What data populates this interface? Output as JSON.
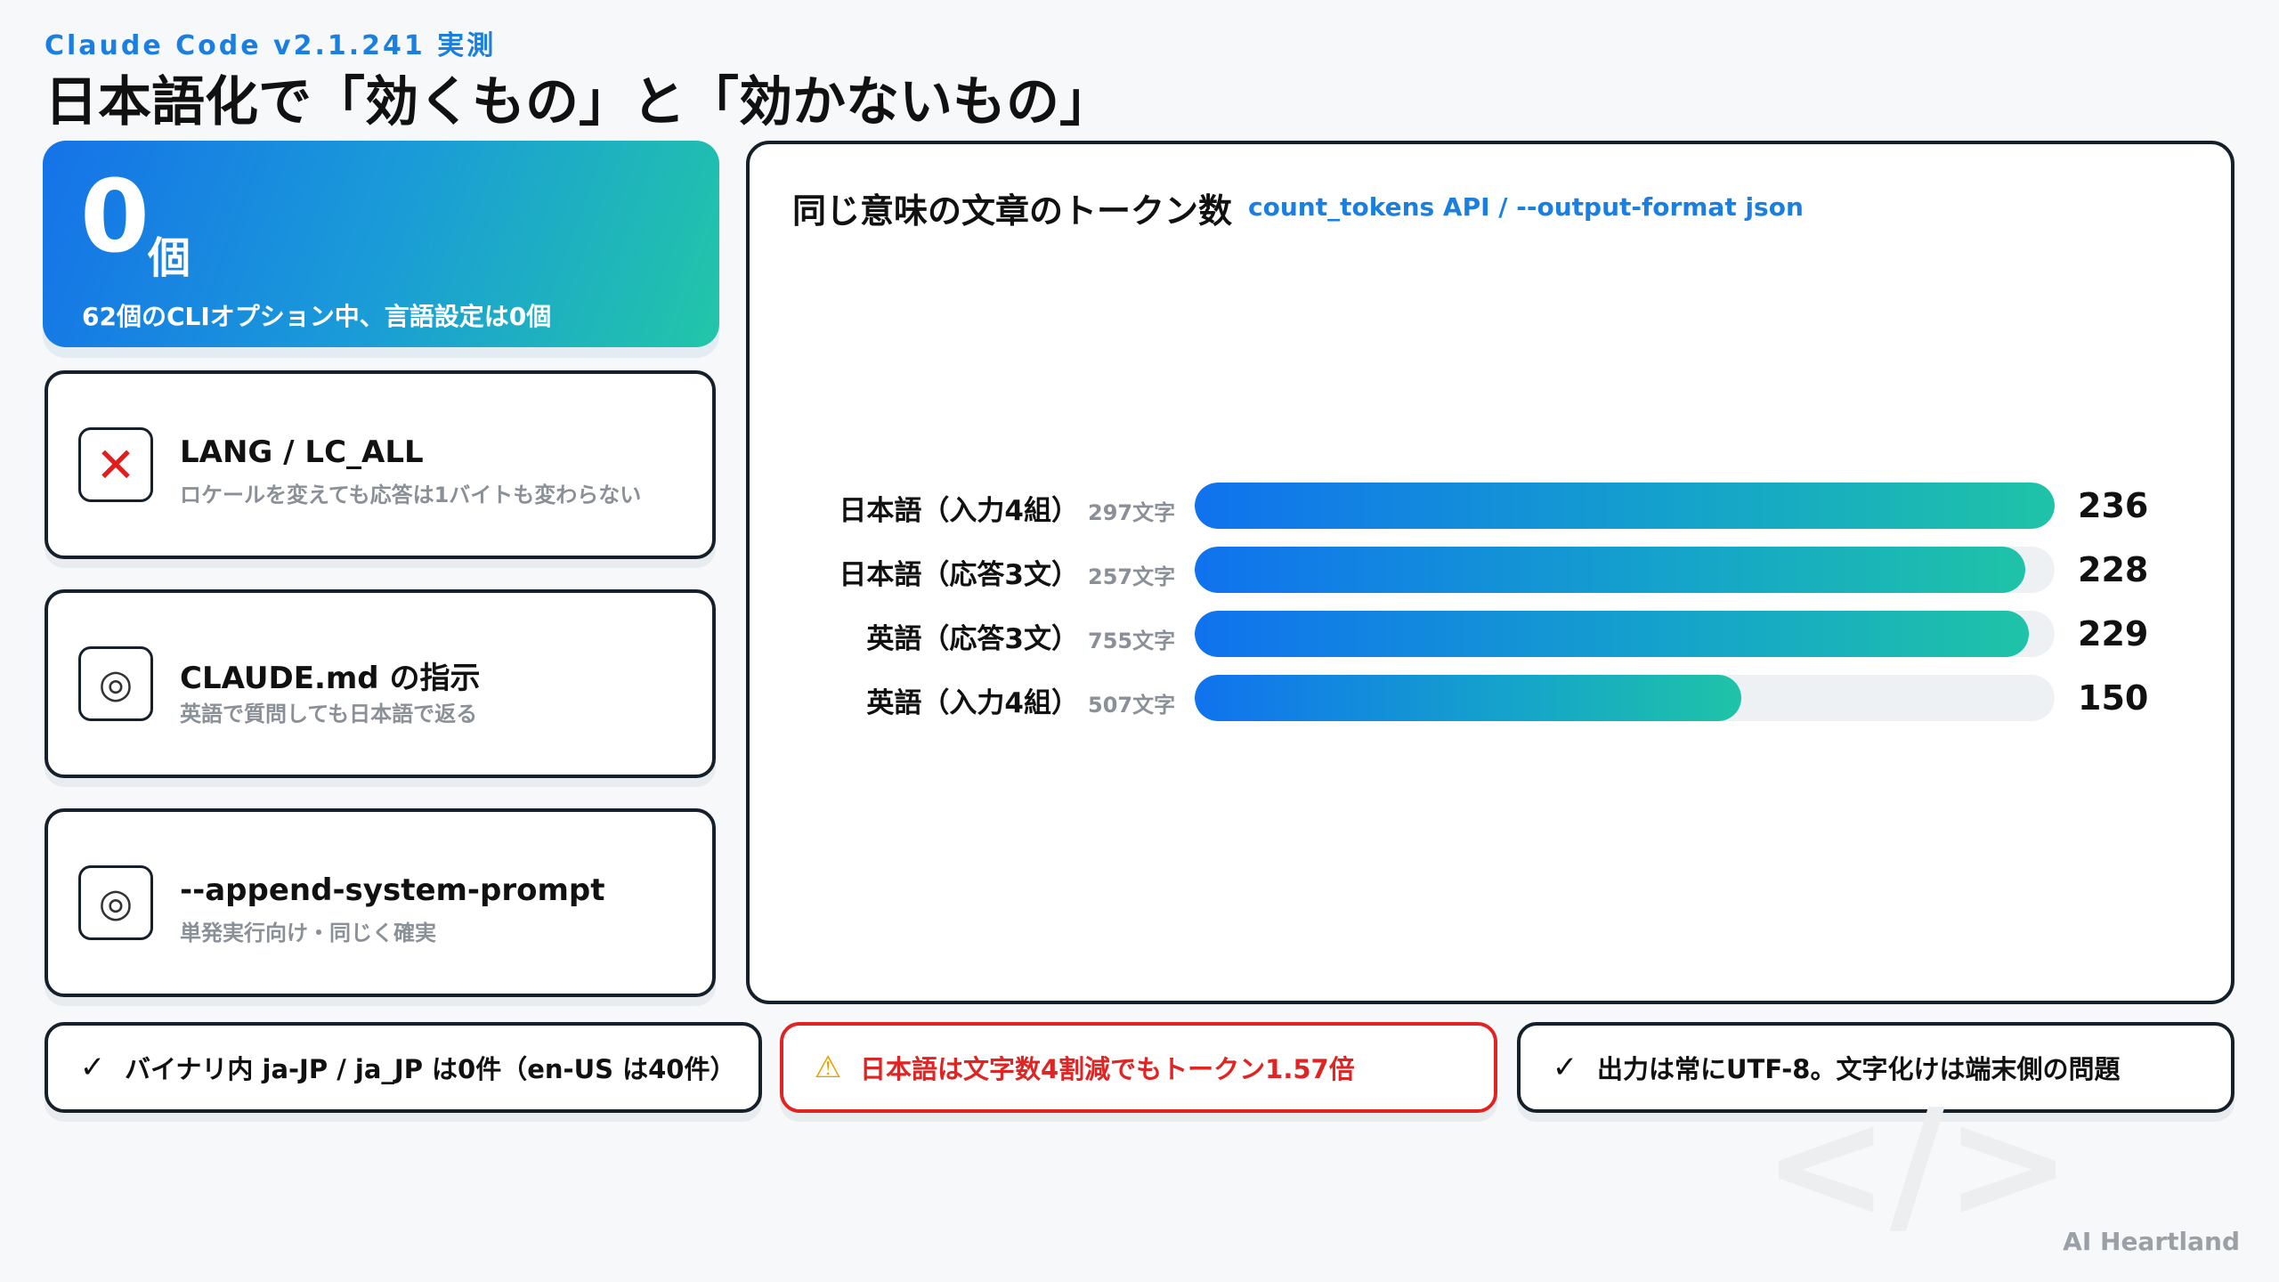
{
  "header": {
    "eyebrow": "Claude Code v2.1.241 実測",
    "title": "日本語化で「効くもの」と「効かないもの」"
  },
  "hero": {
    "number": "0",
    "unit": "個",
    "subtitle": "62個のCLIオプション中、言語設定は0個"
  },
  "options": [
    {
      "icon": "cross-icon",
      "glyph": "✕",
      "title": "LANG / LC_ALL",
      "subtitle": "ロケールを変えても応答は1バイトも変わらない"
    },
    {
      "icon": "circle-icon",
      "glyph": "◎",
      "title": "CLAUDE.md の指示",
      "subtitle": "英語で質問しても日本語で返る"
    },
    {
      "icon": "circle-icon",
      "glyph": "◎",
      "title": "--append-system-prompt",
      "subtitle": "単発実行向け・同じく確実"
    }
  ],
  "chart": {
    "title": "同じ意味の文章のトークン数",
    "subtitle": "count_tokens API / --output-format json"
  },
  "chart_data": {
    "type": "bar",
    "orientation": "horizontal",
    "title": "同じ意味の文章のトークン数",
    "categories": [
      "日本語（入力4組）",
      "日本語（応答3文）",
      "英語（応答3文）",
      "英語（入力4組）"
    ],
    "char_counts": [
      "297文字",
      "257文字",
      "755文字",
      "507文字"
    ],
    "values": [
      236,
      228,
      229,
      150
    ],
    "xlim": [
      0,
      236
    ],
    "colors": {
      "start": "#1072ee",
      "end": "#1fc3a7",
      "track": "#eef1f3"
    }
  },
  "notes": [
    {
      "icon": "check-icon",
      "glyph": "✓",
      "text": "バイナリ内 ja-JP / ja_JP は0件（en-US は40件）"
    },
    {
      "icon": "warning-icon",
      "glyph": "⚠",
      "text": "日本語は文字数4割減でもトークン1.57倍"
    },
    {
      "icon": "check-icon",
      "glyph": "✓",
      "text": "出力は常にUTF-8。文字化けは端末側の問題"
    }
  ],
  "brand": "AI Heartland",
  "colors": {
    "accent": "#1a7fe0",
    "warning": "#e02424",
    "border": "#16202a"
  }
}
